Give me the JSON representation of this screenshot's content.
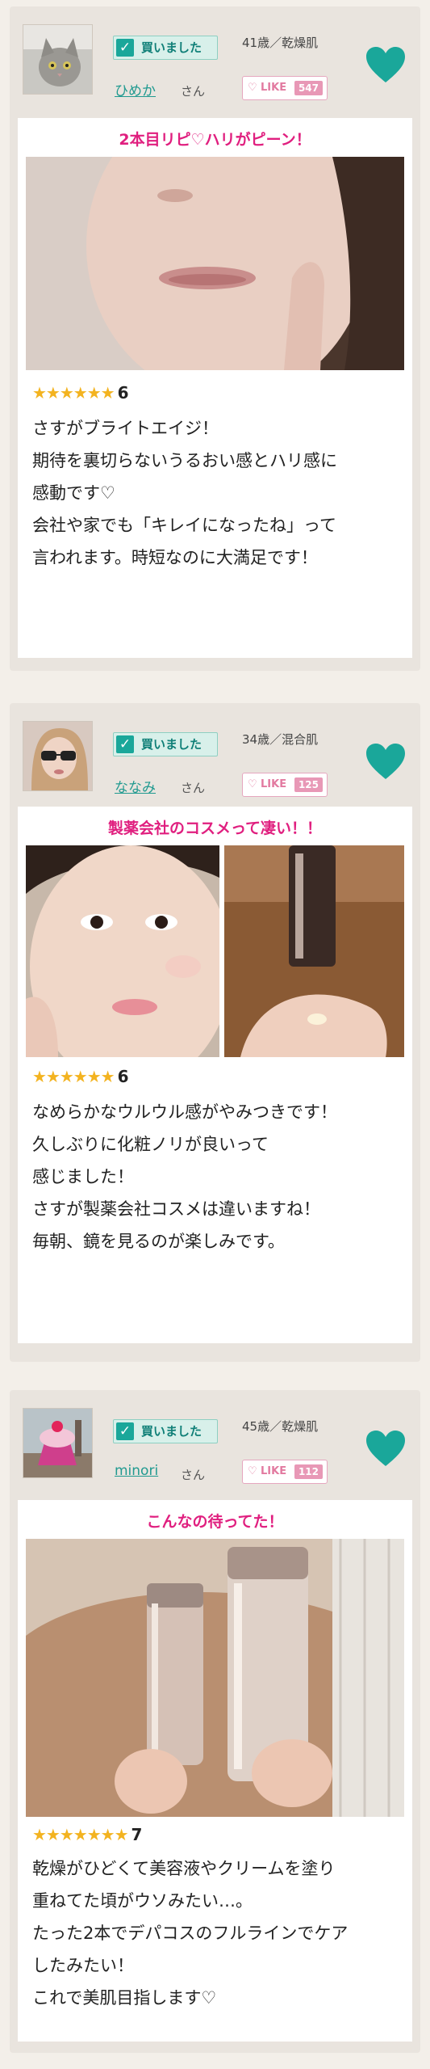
{
  "common": {
    "bought_label": "買いました",
    "san": "さん",
    "like_label": "LIKE",
    "heart_icon": "heart-icon",
    "check_icon": "check-icon",
    "accent": "#1aa79a",
    "title_color": "#e01f7f",
    "like_color": "#e27aa0",
    "star_color": "#f3b320"
  },
  "reviews": [
    {
      "username": "ひめか",
      "age_skin": "41歳／乾燥肌",
      "likes": "547",
      "title": "2本目リピ♡ハリがピーン！",
      "stars": "★★★★★★",
      "rating": "6",
      "body": "さすがブライトエイジ！\n期待を裏切らないうるおい感とハリ感に\n感動です♡\n会社や家でも「キレイになったね」って\n言われます。時短なのに大満足です！"
    },
    {
      "username": "ななみ",
      "age_skin": "34歳／混合肌",
      "likes": "125",
      "title": "製薬会社のコスメって凄い！！",
      "stars": "★★★★★★",
      "rating": "6",
      "body": "なめらかなウルウル感がやみつきです！\n久しぶりに化粧ノリが良いって\n感じました！\nさすが製薬会社コスメは違いますね！\n毎朝、鏡を見るのが楽しみです。"
    },
    {
      "username": "minori",
      "age_skin": "45歳／乾燥肌",
      "likes": "112",
      "title": "こんなの待ってた！",
      "stars": "★★★★★★★",
      "rating": "7",
      "body": "乾燥がひどくて美容液やクリームを塗り\n重ねてた頃がウソみたい…。\nたった2本でデパコスのフルラインでケア\nしたみたい！\nこれで美肌目指します♡"
    }
  ]
}
